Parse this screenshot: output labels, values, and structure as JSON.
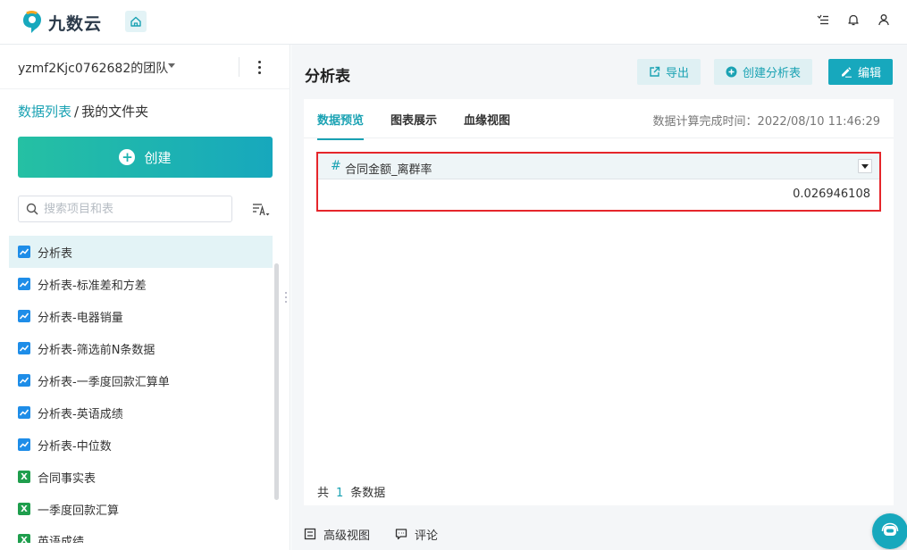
{
  "app": {
    "name": "九数云"
  },
  "header": {
    "icons": [
      "home-icon",
      "task-list-icon",
      "bell-icon",
      "user-icon"
    ]
  },
  "sidebar": {
    "team_name": "yzmf2Kjc0762682的团队",
    "breadcrumb": {
      "root": "数据列表",
      "separator": "/",
      "current": "我的文件夹"
    },
    "create_label": "创建",
    "search": {
      "placeholder": "搜索项目和表"
    },
    "items": [
      {
        "label": "分析表",
        "icon": "chart-icon",
        "active": true
      },
      {
        "label": "分析表-标准差和方差",
        "icon": "chart-icon"
      },
      {
        "label": "分析表-电器销量",
        "icon": "chart-icon"
      },
      {
        "label": "分析表-筛选前N条数据",
        "icon": "chart-icon"
      },
      {
        "label": "分析表-一季度回款汇算单",
        "icon": "chart-icon"
      },
      {
        "label": "分析表-英语成绩",
        "icon": "chart-icon"
      },
      {
        "label": "分析表-中位数",
        "icon": "chart-icon"
      },
      {
        "label": "合同事实表",
        "icon": "excel-icon"
      },
      {
        "label": "一季度回款汇算",
        "icon": "excel-icon"
      },
      {
        "label": "英语成绩",
        "icon": "excel-icon"
      }
    ]
  },
  "main": {
    "title": "分析表",
    "buttons": {
      "export": "导出",
      "create_analysis": "创建分析表",
      "edit": "编辑"
    },
    "tabs": [
      "数据预览",
      "图表展示",
      "血缘视图"
    ],
    "active_tab": "数据预览",
    "calc_time": "数据计算完成时间：2022/08/10 11:46:29",
    "table": {
      "column_type_symbol": "#",
      "column_name": "合同金额_离群率",
      "value": "0.026946108"
    },
    "total": {
      "prefix": "共",
      "count": "1",
      "suffix": "条数据"
    },
    "bottom": {
      "advanced_view": "高级视图",
      "comment": "评论"
    }
  },
  "colors": {
    "accent": "#17a8bd",
    "highlight_border": "#e5262b"
  }
}
